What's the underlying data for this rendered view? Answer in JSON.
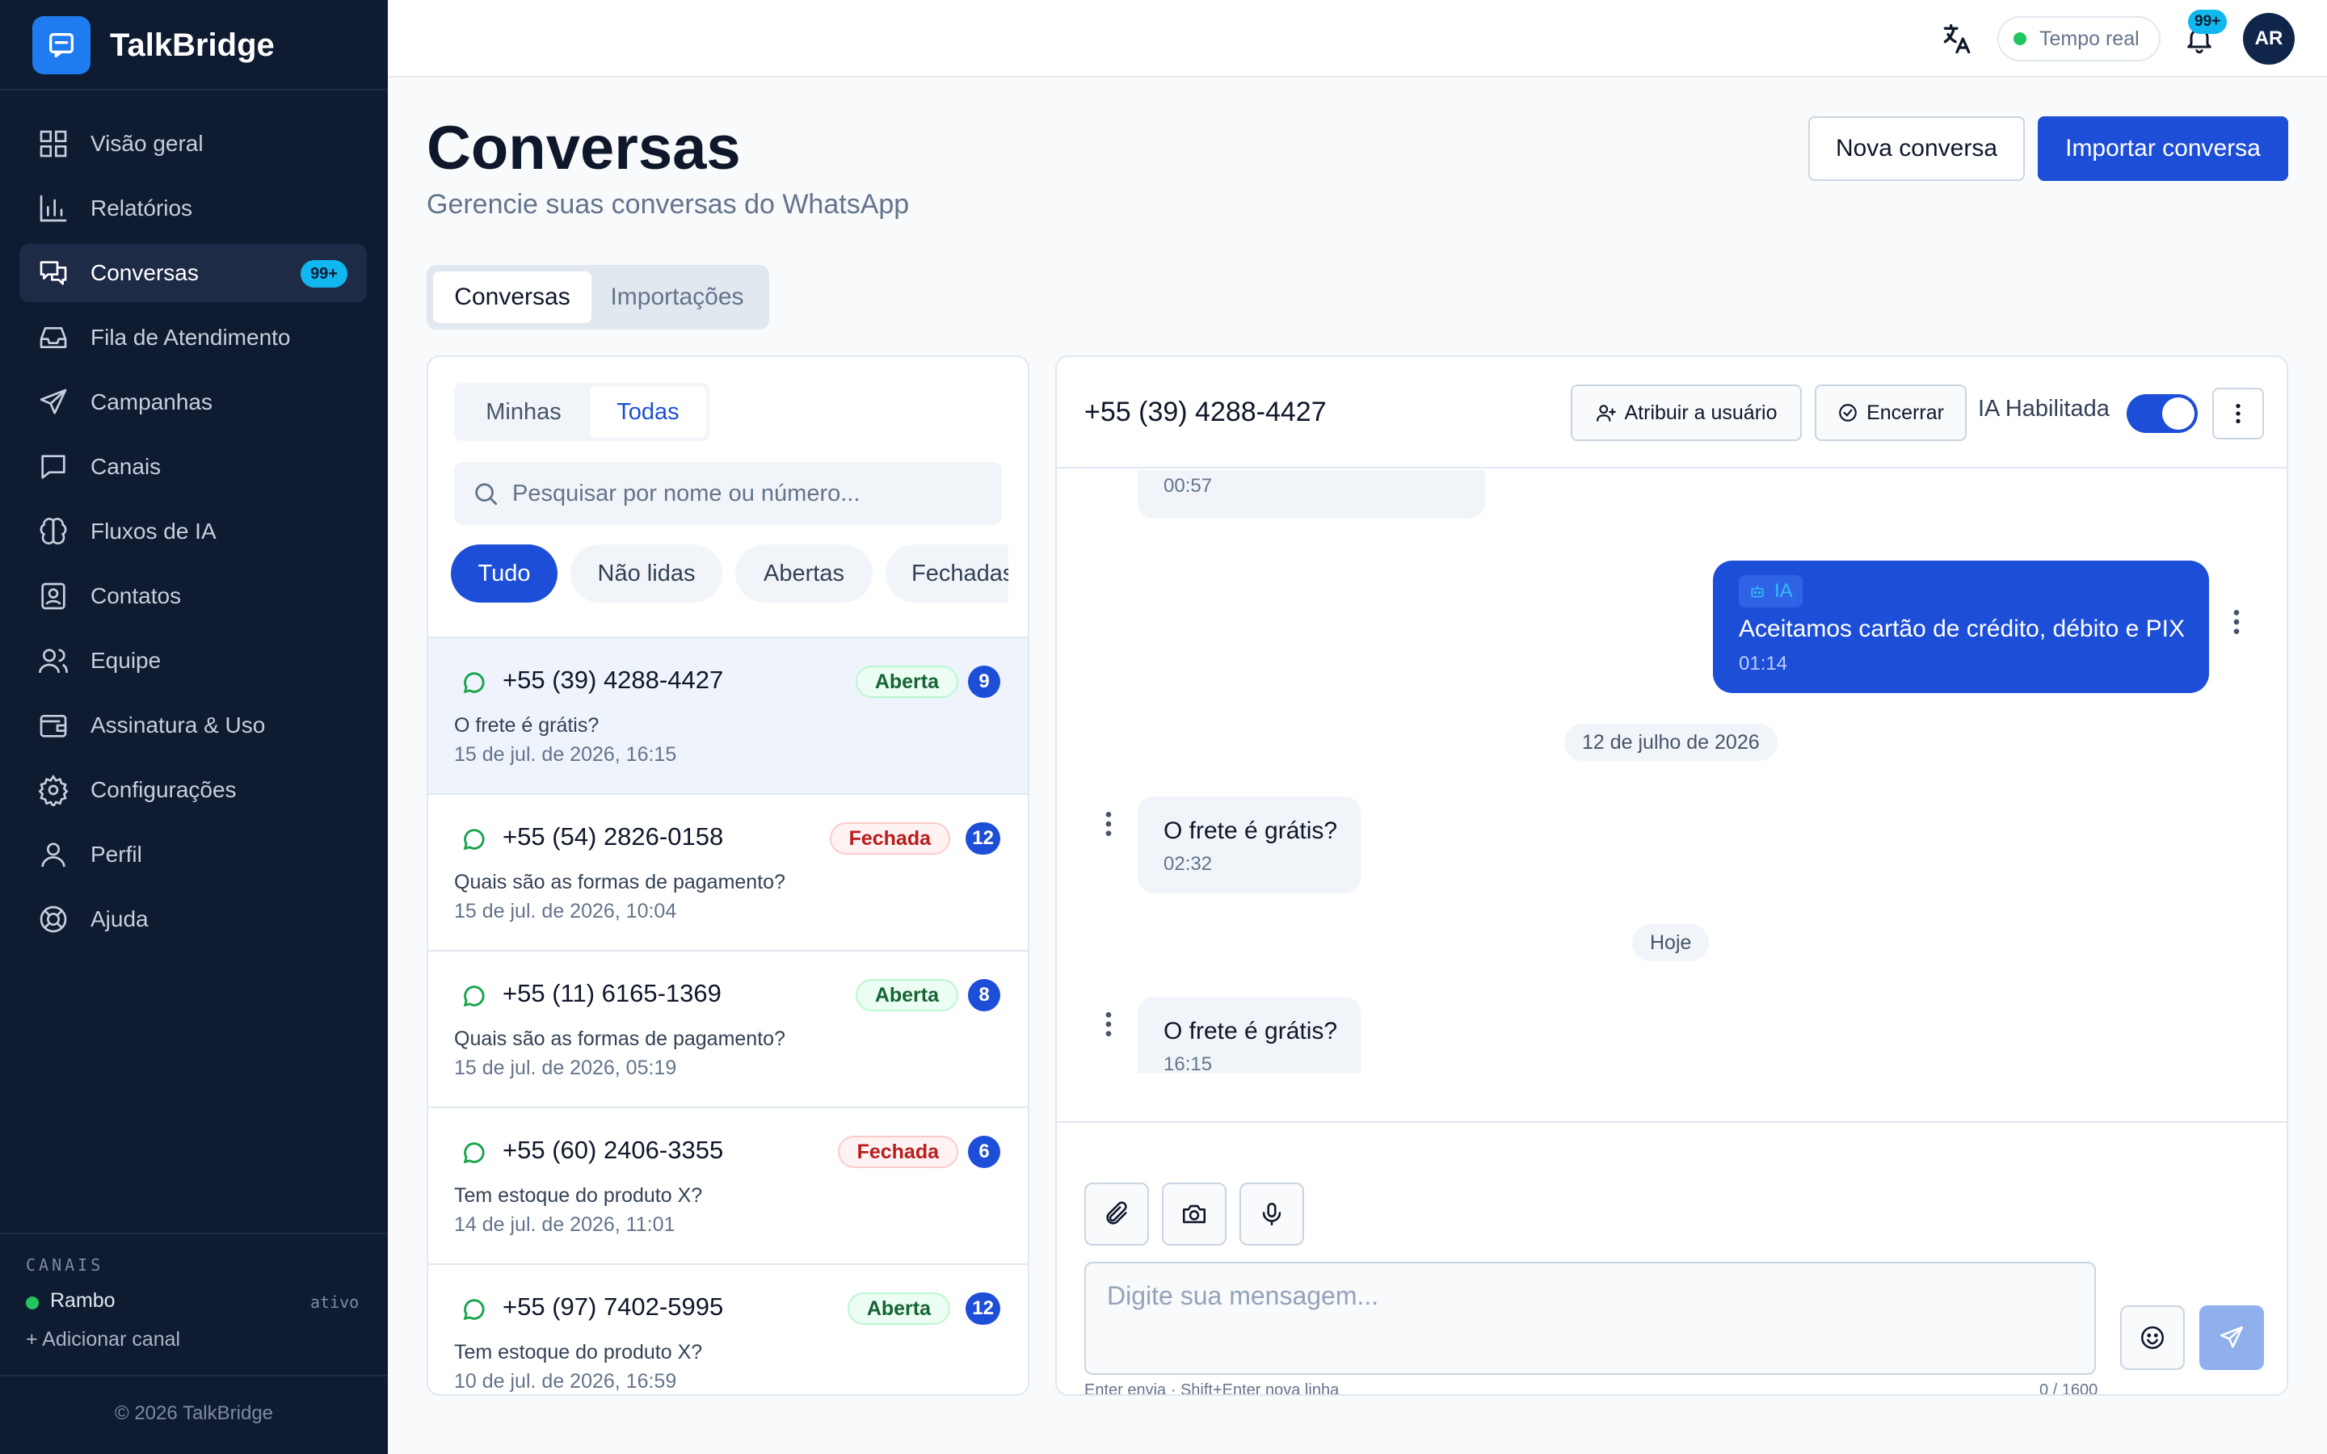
{
  "app": {
    "name": "TalkBridge"
  },
  "sidebar": {
    "items": [
      {
        "label": "Visão geral",
        "icon": "grid-icon"
      },
      {
        "label": "Relatórios",
        "icon": "bar-chart-icon"
      },
      {
        "label": "Conversas",
        "icon": "chat-icon",
        "badge": "99+",
        "active": true
      },
      {
        "label": "Fila de Atendimento",
        "icon": "inbox-icon"
      },
      {
        "label": "Campanhas",
        "icon": "send-icon"
      },
      {
        "label": "Canais",
        "icon": "message-square-icon"
      },
      {
        "label": "Fluxos de IA",
        "icon": "brain-icon"
      },
      {
        "label": "Contatos",
        "icon": "contact-icon"
      },
      {
        "label": "Equipe",
        "icon": "users-icon"
      },
      {
        "label": "Assinatura & Uso",
        "icon": "wallet-icon"
      },
      {
        "label": "Configurações",
        "icon": "gear-icon"
      },
      {
        "label": "Perfil",
        "icon": "user-icon"
      },
      {
        "label": "Ajuda",
        "icon": "lifebuoy-icon"
      }
    ],
    "channels_title": "CANAIS",
    "channel": {
      "name": "Rambo",
      "status": "ativo"
    },
    "add_channel": "+ Adicionar canal",
    "footer": "© 2026 TalkBridge"
  },
  "topbar": {
    "live_label": "Tempo real",
    "notif_badge": "99+",
    "avatar_initials": "AR"
  },
  "page": {
    "title": "Conversas",
    "subtitle": "Gerencie suas conversas do WhatsApp",
    "new_button": "Nova conversa",
    "import_button": "Importar conversa",
    "tabs": [
      "Conversas",
      "Importações"
    ]
  },
  "list": {
    "scope_tabs": [
      "Minhas",
      "Todas"
    ],
    "search_placeholder": "Pesquisar por nome ou número...",
    "filters": [
      "Tudo",
      "Não lidas",
      "Abertas",
      "Fechadas"
    ],
    "conversations": [
      {
        "number": "+55 (39) 4288-4427",
        "status": "Aberta",
        "count": "9",
        "last_message": "O frete é grátis?",
        "date": "15 de jul. de 2026, 16:15"
      },
      {
        "number": "+55 (54) 2826-0158",
        "status": "Fechada",
        "count": "12",
        "last_message": "Quais são as formas de pagamento?",
        "date": "15 de jul. de 2026, 10:04"
      },
      {
        "number": "+55 (11) 6165-1369",
        "status": "Aberta",
        "count": "8",
        "last_message": "Quais são as formas de pagamento?",
        "date": "15 de jul. de 2026, 05:19"
      },
      {
        "number": "+55 (60) 2406-3355",
        "status": "Fechada",
        "count": "6",
        "last_message": "Tem estoque do produto X?",
        "date": "14 de jul. de 2026, 11:01"
      },
      {
        "number": "+55 (97) 7402-5995",
        "status": "Aberta",
        "count": "12",
        "last_message": "Tem estoque do produto X?",
        "date": "10 de jul. de 2026, 16:59"
      }
    ]
  },
  "chat": {
    "contact": "+55 (39) 4288-4427",
    "assign_button": "Atribuir a usuário",
    "close_button": "Encerrar",
    "ai_label": "IA Habilitada",
    "ai_enabled": true,
    "messages": [
      {
        "time": "00:57"
      },
      {
        "tag": "IA",
        "text": "Aceitamos cartão de crédito, débito e PIX",
        "time": "01:14"
      },
      {
        "date": "12 de julho de 2026"
      },
      {
        "text": "O frete é grátis?",
        "time": "02:32"
      },
      {
        "date": "Hoje"
      },
      {
        "text": "O frete é grátis?",
        "time": "16:15"
      }
    ],
    "input_placeholder": "Digite sua mensagem...",
    "hint": "Enter envia · Shift+Enter nova linha",
    "counter": "0 / 1600"
  },
  "colors": {
    "sidebar_bg": "#0f1b31",
    "primary": "#1d4ed8",
    "badge": "#11b8f0",
    "online": "#22c55e"
  }
}
